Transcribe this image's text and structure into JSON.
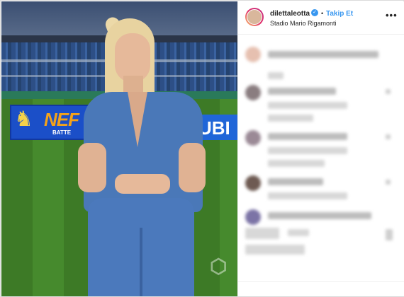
{
  "post": {
    "username": "dilettaleotta",
    "separator": "•",
    "follow_label": "Takip Et",
    "location": "Stadio Mario Rigamonti",
    "more_label": "•••"
  },
  "photo": {
    "board_left_text": "NEF",
    "board_left_sub": "BATTE",
    "board_right_text": "UBI"
  },
  "icons": {
    "verified": "verified-badge-icon",
    "more": "more-options-icon"
  },
  "colors": {
    "link_blue": "#3897f0",
    "text": "#262626",
    "border": "#dbdbdb"
  }
}
